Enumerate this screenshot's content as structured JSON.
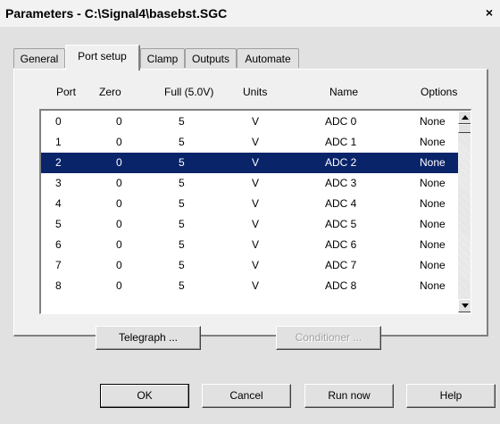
{
  "window": {
    "title": "Parameters - C:\\Signal4\\basebst.SGC",
    "close_glyph": "×"
  },
  "tabs": [
    {
      "label": "General",
      "active": false
    },
    {
      "label": "Port setup",
      "active": true
    },
    {
      "label": "Clamp",
      "active": false
    },
    {
      "label": "Outputs",
      "active": false
    },
    {
      "label": "Automate",
      "active": false
    }
  ],
  "columns": [
    "Port",
    "Zero",
    "Full (5.0V)",
    "Units",
    "Name",
    "Options"
  ],
  "rows": [
    {
      "port": "0",
      "zero": "0",
      "full": "5",
      "units": "V",
      "name": "ADC 0",
      "options": "None"
    },
    {
      "port": "1",
      "zero": "0",
      "full": "5",
      "units": "V",
      "name": "ADC 1",
      "options": "None"
    },
    {
      "port": "2",
      "zero": "0",
      "full": "5",
      "units": "V",
      "name": "ADC 2",
      "options": "None"
    },
    {
      "port": "3",
      "zero": "0",
      "full": "5",
      "units": "V",
      "name": "ADC 3",
      "options": "None"
    },
    {
      "port": "4",
      "zero": "0",
      "full": "5",
      "units": "V",
      "name": "ADC 4",
      "options": "None"
    },
    {
      "port": "5",
      "zero": "0",
      "full": "5",
      "units": "V",
      "name": "ADC 5",
      "options": "None"
    },
    {
      "port": "6",
      "zero": "0",
      "full": "5",
      "units": "V",
      "name": "ADC 6",
      "options": "None"
    },
    {
      "port": "7",
      "zero": "0",
      "full": "5",
      "units": "V",
      "name": "ADC 7",
      "options": "None"
    },
    {
      "port": "8",
      "zero": "0",
      "full": "5",
      "units": "V",
      "name": "ADC 8",
      "options": "None"
    }
  ],
  "selected_row_index": 2,
  "colors": {
    "selection": "#0a246a",
    "selection_text": "#ffffff",
    "dialog_bg": "#e1e1e1"
  },
  "panel_buttons": {
    "telegraph": "Telegraph ...",
    "conditioner": "Conditioner ..."
  },
  "footer_buttons": {
    "ok": "OK",
    "cancel": "Cancel",
    "run_now": "Run now",
    "help": "Help"
  }
}
